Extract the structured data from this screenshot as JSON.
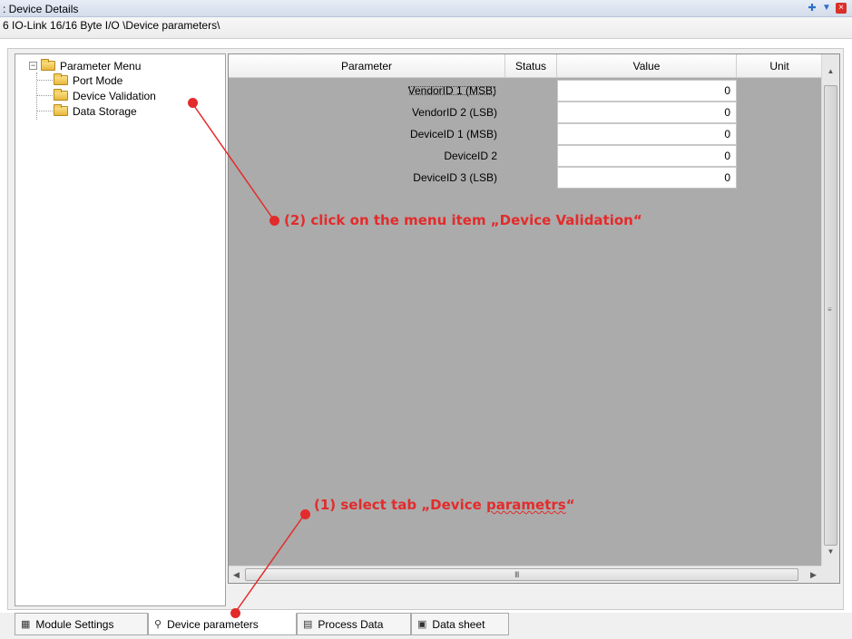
{
  "window": {
    "title": "Device Details",
    "path": "6 IO-Link 16/16 Byte I/O \\Device parameters\\",
    "controls": {
      "pin_icon": "pin-icon",
      "dropdown_icon": "chevron-down-icon",
      "close_icon": "close-icon"
    }
  },
  "tree": {
    "root": {
      "label": "Parameter Menu",
      "expander": "−"
    },
    "items": [
      {
        "label": "Port Mode"
      },
      {
        "label": "Device Validation"
      },
      {
        "label": "Data Storage"
      }
    ]
  },
  "grid": {
    "columns": [
      "Parameter",
      "Status",
      "Value",
      "Unit"
    ],
    "rows": [
      {
        "parameter": "VendorID 1 (MSB)",
        "status": "",
        "value": "0",
        "unit": ""
      },
      {
        "parameter": "VendorID 2 (LSB)",
        "status": "",
        "value": "0",
        "unit": ""
      },
      {
        "parameter": "DeviceID 1 (MSB)",
        "status": "",
        "value": "0",
        "unit": ""
      },
      {
        "parameter": "DeviceID 2",
        "status": "",
        "value": "0",
        "unit": ""
      },
      {
        "parameter": "DeviceID 3 (LSB)",
        "status": "",
        "value": "0",
        "unit": ""
      }
    ],
    "scroll": {
      "up": "▲",
      "down": "▼",
      "left": "◀",
      "right": "▶",
      "vgrip": "≡",
      "hgrip": "III"
    }
  },
  "tabs": [
    {
      "label": "Module Settings",
      "icon": "module-settings-icon",
      "glyph": "▦"
    },
    {
      "label": "Device parameters",
      "icon": "wrench-icon",
      "glyph": "⚲",
      "active": true
    },
    {
      "label": "Process Data",
      "icon": "binary-data-icon",
      "glyph": "▤"
    },
    {
      "label": "Data sheet",
      "icon": "document-icon",
      "glyph": "▣"
    }
  ],
  "annotations": {
    "step2_prefix": "(2) click on the menu item „Device Validation“",
    "step1_prefix": "(1) select tab „Device ",
    "step1_word": "parametrs",
    "step1_suffix": "“",
    "color": "#e32b2b"
  }
}
